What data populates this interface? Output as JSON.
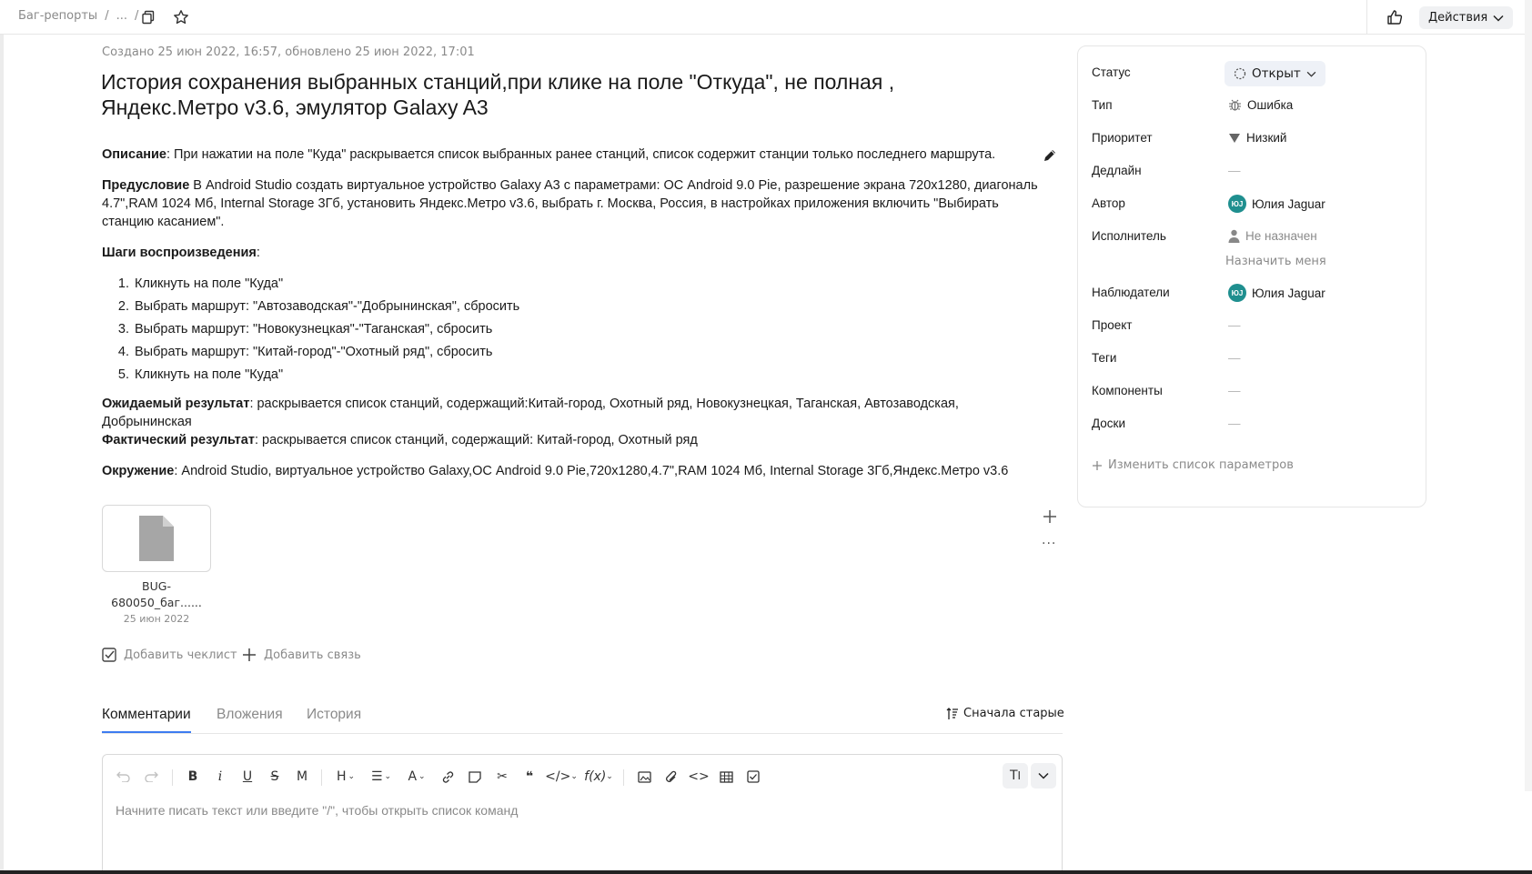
{
  "breadcrumb": {
    "root": "Баг-репорты",
    "sep1": "/",
    "ellipsis": "...",
    "sep2": "/"
  },
  "topbar": {
    "actions_label": "Действия",
    "icons": [
      "copy-icon",
      "star-icon",
      "like-icon"
    ]
  },
  "issue": {
    "meta": "Создано 25 июн 2022, 16:57, обновлено 25 июн 2022, 17:01",
    "title": "История сохранения выбранных станций,при клике на поле \"Откуда\", не полная , Яндекс.Метро v3.6, эмулятор Galaxy A3",
    "description": {
      "desc_label": "Описание",
      "desc_text": ": При нажатии на поле \"Куда\" раскрывается список выбранных ранее станций, список содержит станции только последнего маршрута.",
      "pre_label": "Предусловие",
      "pre_text": " В Android Studio создать виртуальное устройство Galaxy A3 с параметрами: ОС Android 9.0 Pie, разрешение экрана 720x1280, диагональ 4.7\",RAM 1024 Мб, Internal Storage 3Гб, установить Яндекс.Метро v3.6, выбрать г. Москва, Россия, в настройках приложения включить \"Выбирать станцию касанием\".",
      "steps_label": "Шаги воспроизведения",
      "steps_colon": ":",
      "steps": [
        "Кликнуть на поле \"Куда\"",
        "Выбрать маршрут: \"Автозаводская\"-\"Добрынинская\", сбросить",
        "Выбрать маршрут: \"Новокузнецкая\"-\"Таганская\", сбросить",
        "Выбрать маршрут: \"Китай-город\"-\"Охотный ряд\", сбросить",
        "Кликнуть на поле \"Куда\""
      ],
      "expected_label": "Ожидаемый результат",
      "expected_text": ": раскрывается список станций, содержащий:Китай-город, Охотный ряд, Новокузнецкая, Таганская, Автозаводская, Добрынинская",
      "actual_label": "Фактический результат",
      "actual_text": ": раскрывается список станций, содержащий: Китай-город, Охотный ряд",
      "env_label": "Окружение",
      "env_text": ": Android Studio, виртуальное устройство Galaxy,ОС Android 9.0 Pie,720x1280,4.7\",RAM 1024 Мб, Internal Storage 3Гб,Яндекс.Метро v3.6"
    },
    "attachment": {
      "name": "BUG-680050_баг......",
      "date": "25 июн 2022"
    },
    "add_checklist": "Добавить чеклист",
    "add_link": "Добавить связь",
    "more": "···"
  },
  "tabs": [
    {
      "label": "Комментарии",
      "active": true
    },
    {
      "label": "Вложения",
      "active": false
    },
    {
      "label": "История",
      "active": false
    }
  ],
  "sort_label": "Сначала старые",
  "editor": {
    "placeholder": "Начните писать текст или введите \"/\", чтобы открыть список команд",
    "tools": [
      "undo-icon",
      "redo-icon",
      "bold-icon",
      "italic-icon",
      "underline-icon",
      "strike-icon",
      "monospace-icon",
      "heading-icon",
      "list-icon",
      "text-color-icon",
      "link-icon",
      "note-icon",
      "cut-icon",
      "quote-icon",
      "code-block-icon",
      "formula-icon",
      "image-icon",
      "attach-icon",
      "code-icon",
      "table-icon",
      "checkbox-icon",
      "text-mode-icon",
      "expand-icon"
    ]
  },
  "sidebar": {
    "status": {
      "label": "Статус",
      "value": "Открыт"
    },
    "type": {
      "label": "Тип",
      "value": "Ошибка"
    },
    "priority": {
      "label": "Приоритет",
      "value": "Низкий"
    },
    "deadline": {
      "label": "Дедлайн",
      "value": "—"
    },
    "author": {
      "label": "Автор",
      "value": "Юлия Jaguar",
      "initials": "ЮJ"
    },
    "assignee": {
      "label": "Исполнитель",
      "value": "Не назначен",
      "assign_me": "Назначить меня"
    },
    "followers": {
      "label": "Наблюдатели",
      "value": "Юлия Jaguar",
      "initials": "ЮJ"
    },
    "project": {
      "label": "Проект",
      "value": "—"
    },
    "tags": {
      "label": "Теги",
      "value": "—"
    },
    "components": {
      "label": "Компоненты",
      "value": "—"
    },
    "boards": {
      "label": "Доски",
      "value": "—"
    },
    "change_params": "Изменить список параметров"
  },
  "colors": {
    "accent": "#3d7cf0",
    "avatar": "#1f8f8f",
    "muted": "#8a8a8a"
  }
}
